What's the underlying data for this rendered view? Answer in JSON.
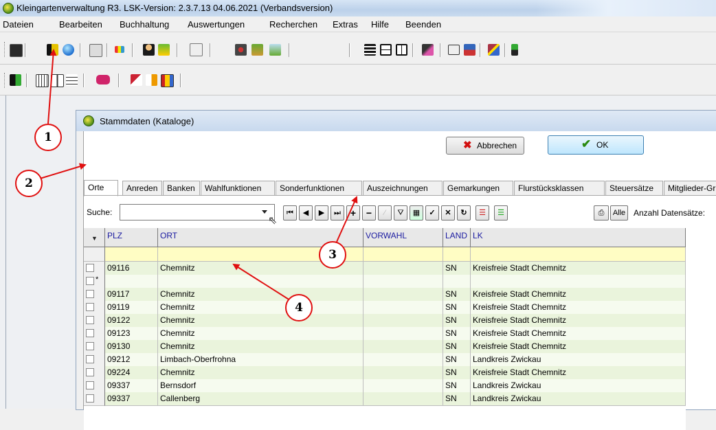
{
  "app": {
    "title": "Kleingartenverwaltung R3.  LSK-Version: 2.3.7.13   04.06.2021 (Verbandsversion)"
  },
  "menu": [
    {
      "label": "Dateien"
    },
    {
      "label": "Bearbeiten"
    },
    {
      "label": "Buchhaltung"
    },
    {
      "label": "Auswertungen"
    },
    {
      "label": "Recherchen"
    },
    {
      "label": "Extras"
    },
    {
      "label": "Hilfe"
    },
    {
      "label": "Beenden"
    }
  ],
  "window": {
    "title": "Stammdaten (Kataloge)",
    "cancel_label": "Abbrechen",
    "ok_label": "OK"
  },
  "tabs": [
    {
      "label": "Orte",
      "active": true
    },
    {
      "label": "Anreden"
    },
    {
      "label": "Banken"
    },
    {
      "label": "Wahlfunktionen"
    },
    {
      "label": "Sonderfunktionen"
    },
    {
      "label": "Auszeichnungen"
    },
    {
      "label": "Gemarkungen"
    },
    {
      "label": "Flurstücksklassen"
    },
    {
      "label": "Steuersätze"
    },
    {
      "label": "Mitglieder-Gru"
    }
  ],
  "search": {
    "label": "Suche:",
    "value": "",
    "all_label": "Alle",
    "count_label": "Anzahl Datensätze:"
  },
  "grid": {
    "columns": [
      "PLZ",
      "ORT",
      "VORWAHL",
      "LAND",
      "LK"
    ],
    "rows": [
      {
        "plz": "09116",
        "ort": "Chemnitz",
        "vorwahl": "",
        "land": "SN",
        "lk": "Kreisfreie Stadt Chemnitz",
        "marker": ""
      },
      {
        "plz": "",
        "ort": "",
        "vorwahl": "",
        "land": "",
        "lk": "",
        "marker": "*"
      },
      {
        "plz": "09117",
        "ort": "Chemnitz",
        "vorwahl": "",
        "land": "SN",
        "lk": "Kreisfreie Stadt Chemnitz",
        "marker": ""
      },
      {
        "plz": "09119",
        "ort": "Chemnitz",
        "vorwahl": "",
        "land": "SN",
        "lk": "Kreisfreie Stadt Chemnitz",
        "marker": ""
      },
      {
        "plz": "09122",
        "ort": "Chemnitz",
        "vorwahl": "",
        "land": "SN",
        "lk": "Kreisfreie Stadt Chemnitz",
        "marker": ""
      },
      {
        "plz": "09123",
        "ort": "Chemnitz",
        "vorwahl": "",
        "land": "SN",
        "lk": "Kreisfreie Stadt Chemnitz",
        "marker": ""
      },
      {
        "plz": "09130",
        "ort": "Chemnitz",
        "vorwahl": "",
        "land": "SN",
        "lk": "Kreisfreie Stadt Chemnitz",
        "marker": ""
      },
      {
        "plz": "09212",
        "ort": "Limbach-Oberfrohna",
        "vorwahl": "",
        "land": "SN",
        "lk": "Landkreis Zwickau",
        "marker": ""
      },
      {
        "plz": "09224",
        "ort": "Chemnitz",
        "vorwahl": "",
        "land": "SN",
        "lk": "Kreisfreie Stadt Chemnitz",
        "marker": ""
      },
      {
        "plz": "09337",
        "ort": "Bernsdorf",
        "vorwahl": "",
        "land": "SN",
        "lk": "Landkreis Zwickau",
        "marker": ""
      },
      {
        "plz": "09337",
        "ort": "Callenberg",
        "vorwahl": "",
        "land": "SN",
        "lk": "Landkreis Zwickau",
        "marker": ""
      }
    ]
  },
  "callouts": [
    "1",
    "2",
    "3",
    "4"
  ],
  "colors": {
    "header_text": "#1a1aa0",
    "row_green": "#eaf4dc",
    "row_white": "#f6fbef",
    "filter_row": "#fffdc4",
    "callout": "#e01010"
  }
}
